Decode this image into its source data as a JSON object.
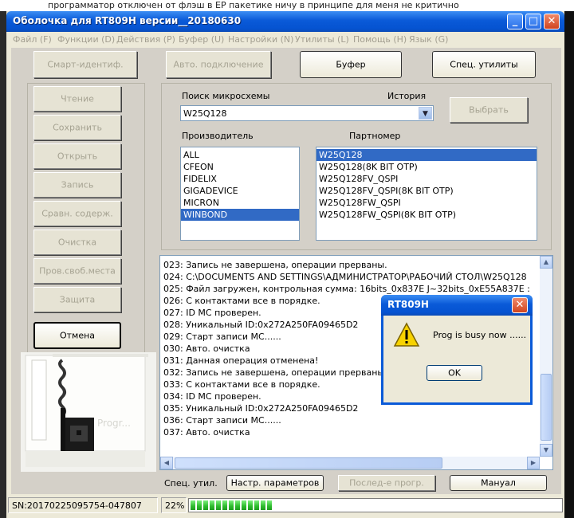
{
  "background": {
    "top_text": "программатор отключен от флэш в ЕР пакетике ничу в принципе для меня не критично"
  },
  "window": {
    "title": "Оболочка для RT809H версии__20180630",
    "minimize": "_",
    "maximize": "□",
    "close": "✕"
  },
  "menu": [
    "Файл (F)",
    "Функции (D)",
    "Действия (P)",
    "Буфер (U)",
    "Настройки (N)",
    "Утилиты (L)",
    "Помощь (H)",
    "Язык (G)"
  ],
  "top_buttons": {
    "smart_id": "Смарт-идентиф.",
    "auto_connect": "Авто. подключение",
    "buffer": "Буфер",
    "special_utils": "Спец. утилиты"
  },
  "side_buttons": {
    "read": "Чтение",
    "save": "Сохранить",
    "open": "Открыть",
    "write": "Запись",
    "compare": "Сравн. содерж.",
    "erase": "Очистка",
    "blank_check": "Пров.своб.места",
    "protect": "Защита",
    "cancel": "Отмена"
  },
  "search": {
    "label": "Поиск микросхемы",
    "history_label": "История",
    "value": "W25Q128",
    "select_button": "Выбрать"
  },
  "manufacturer": {
    "label": "Производитель",
    "items": [
      "ALL",
      "CFEON",
      "FIDELIX",
      "GIGADEVICE",
      "MICRON",
      "WINBOND"
    ],
    "selected": "WINBOND"
  },
  "partnumber": {
    "label": "Партномер",
    "items": [
      "W25Q128",
      "W25Q128(8K BIT OTP)",
      "W25Q128FV_QSPI",
      "W25Q128FV_QSPI(8K BIT OTP)",
      "W25Q128FW_QSPI",
      "W25Q128FW_QSPI(8K BIT OTP)"
    ],
    "selected": "W25Q128"
  },
  "log": [
    "023:  Запись не завершена, операции прерваны.",
    "024:  C:\\DOCUMENTS AND SETTINGS\\АДМИНИСТРАТОР\\РАБОЧИЙ СТОЛ\\W25Q128",
    "025:  Файл загружен, контрольная сумма: 16bits_0x837E J~32bits_0xE55A837E :",
    "026:  С контактами все в порядке.",
    "027:  ID MC проверен.",
    "028:  Уникальный ID:0x272A250FA09465D2",
    "029:  Старт записи MC......",
    "030:  Авто. очистка",
    "031:  Данная операция отменена!",
    "032:  Запись не завершена, операции прерваны.",
    "033:  С контактами все в порядке.",
    "034:  ID MC проверен.",
    "035:  Уникальный ID:0x272A250FA09465D2",
    "036:  Старт записи MC......",
    "037:  Авто. очистка"
  ],
  "photo": {
    "caption": "Progr..."
  },
  "bottom": {
    "special_label": "Спец. утил.",
    "settings_button": "Настр. параметров",
    "last_prog_button": "Послед-е прогр.",
    "manual_button": "Мануал"
  },
  "status": {
    "serial": "SN:20170225095754-047807",
    "percent": "22%",
    "progress_fraction": 0.22
  },
  "dialog": {
    "title": "RT809H",
    "message": "Prog is busy now ......",
    "ok": "OK",
    "close": "✕"
  },
  "colors": {
    "titlebar": "#0a5ad8",
    "selection": "#316ac5",
    "progress": "#2dbb2d"
  }
}
